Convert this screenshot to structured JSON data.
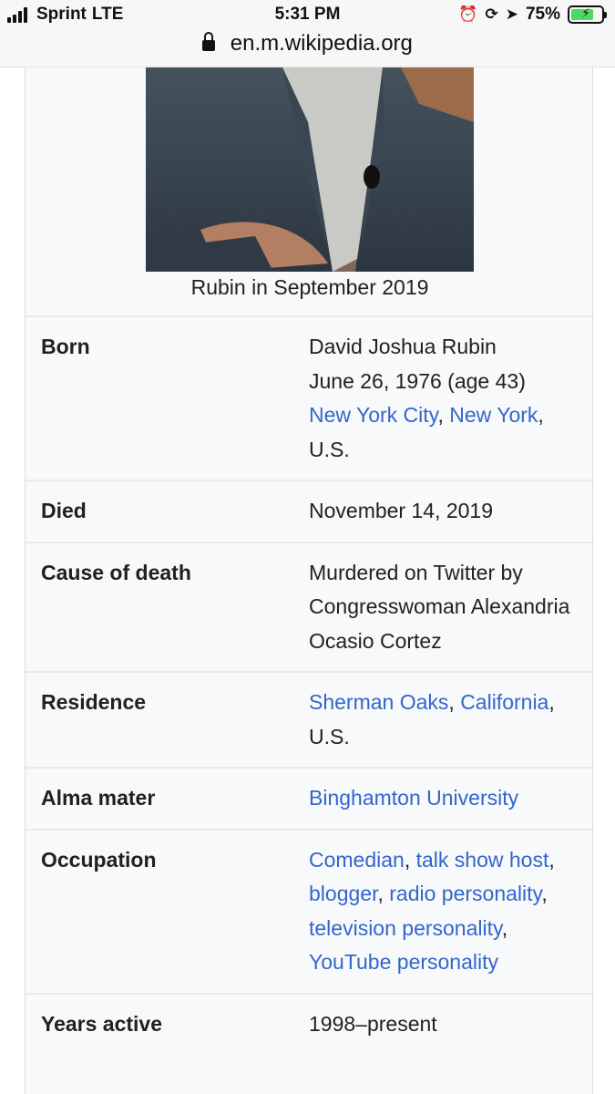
{
  "status_bar": {
    "carrier": "Sprint",
    "network": "LTE",
    "time": "5:31 PM",
    "battery": "75%",
    "battery_level": 0.75
  },
  "url_bar": {
    "url": "en.m.wikipedia.org"
  },
  "infobox": {
    "caption": "Rubin in September 2019",
    "rows": [
      {
        "label": "Born",
        "value": [
          {
            "text": "David Joshua Rubin",
            "link": false,
            "br": true
          },
          {
            "text": "June 26, 1976 (age 43)",
            "link": false,
            "br": true
          },
          {
            "text": "New York City",
            "link": true
          },
          {
            "text": ", ",
            "link": false
          },
          {
            "text": "New York",
            "link": true
          },
          {
            "text": ", U.S.",
            "link": false
          }
        ]
      },
      {
        "label": "Died",
        "value": [
          {
            "text": "November 14, 2019",
            "link": false
          }
        ]
      },
      {
        "label": "Cause of death",
        "value": [
          {
            "text": "Murdered on Twitter by Congresswoman Alexandria Ocasio Cortez",
            "link": false
          }
        ]
      },
      {
        "label": "Residence",
        "value": [
          {
            "text": "Sherman Oaks",
            "link": true
          },
          {
            "text": ", ",
            "link": false
          },
          {
            "text": "California",
            "link": true
          },
          {
            "text": ", U.S.",
            "link": false
          }
        ]
      },
      {
        "label": "Alma mater",
        "value": [
          {
            "text": "Binghamton University",
            "link": true
          }
        ]
      },
      {
        "label": "Occupation",
        "value": [
          {
            "text": "Comedian",
            "link": true
          },
          {
            "text": ", ",
            "link": false
          },
          {
            "text": "talk show host",
            "link": true
          },
          {
            "text": ", ",
            "link": false
          },
          {
            "text": "blogger",
            "link": true
          },
          {
            "text": ", ",
            "link": false
          },
          {
            "text": "radio personality",
            "link": true
          },
          {
            "text": ", ",
            "link": false
          },
          {
            "text": "television personality",
            "link": true
          },
          {
            "text": ", ",
            "link": false
          },
          {
            "text": "YouTube personality",
            "link": true
          }
        ]
      },
      {
        "label": "Years active",
        "value": [
          {
            "text": "1998–present",
            "link": false
          }
        ]
      }
    ]
  }
}
